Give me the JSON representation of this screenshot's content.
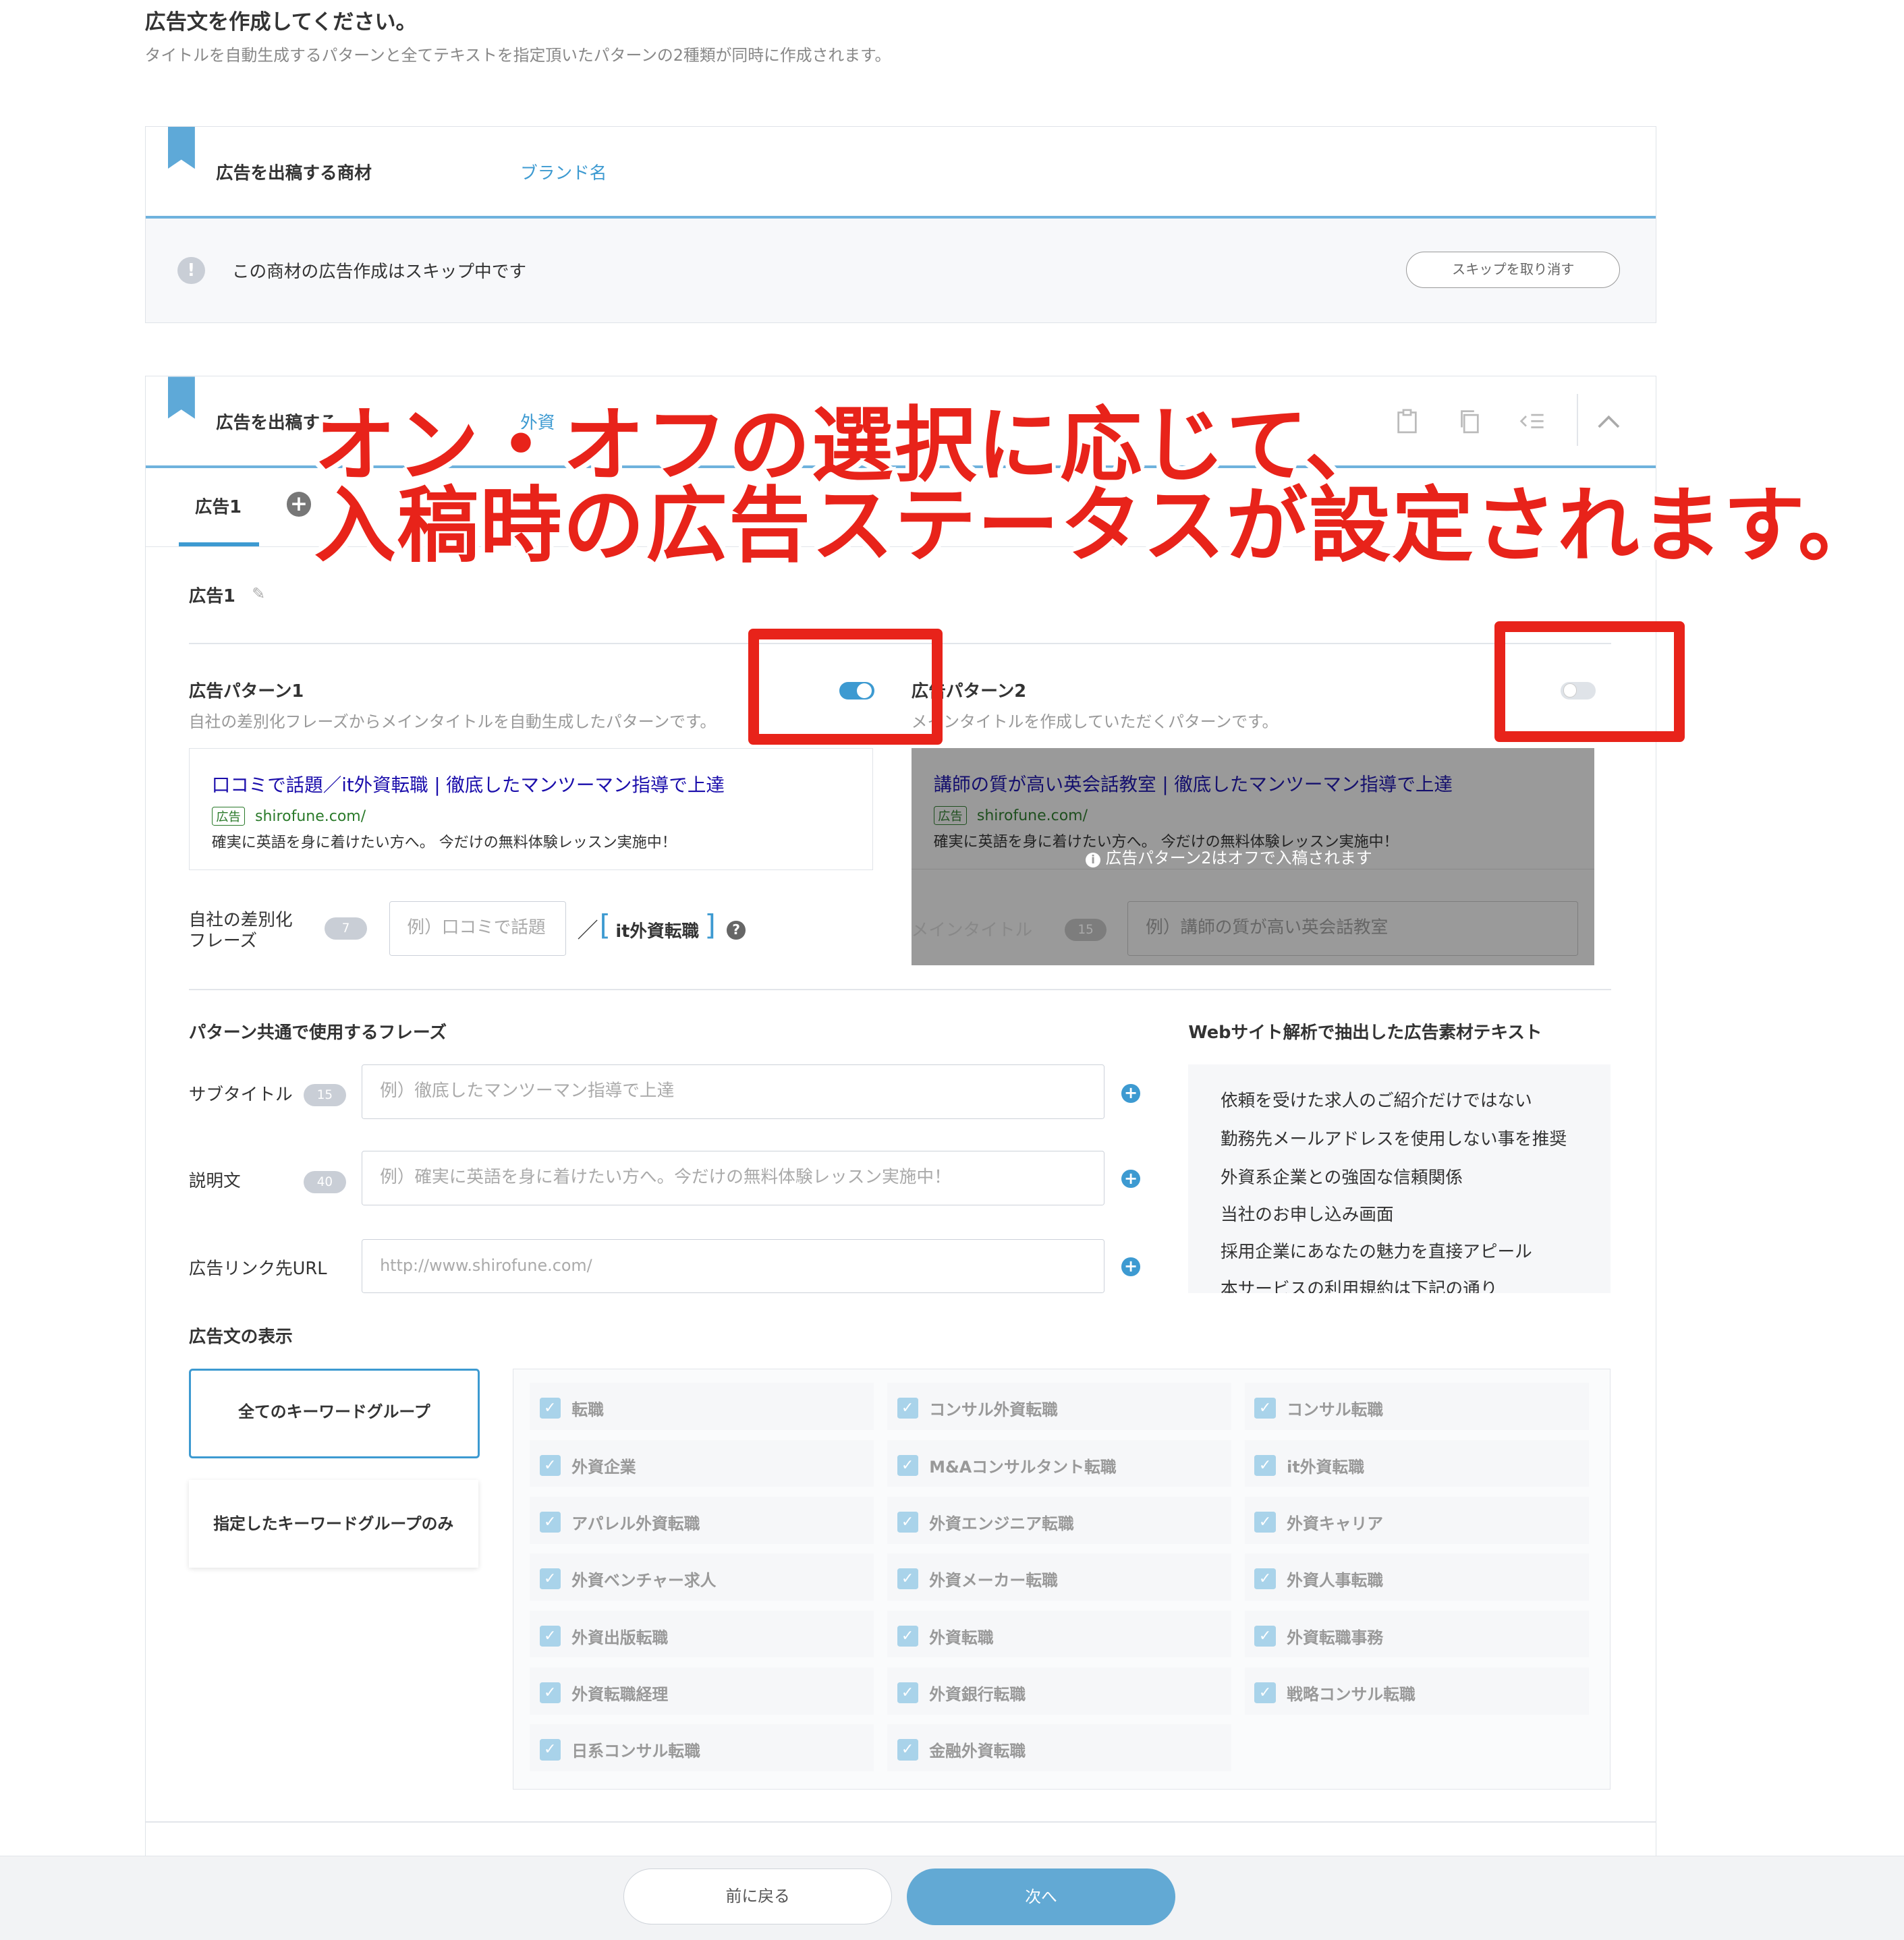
{
  "page": {
    "title": "広告文を作成してください。",
    "subtitle": "タイトルを自動生成するパターンと全てテキストを指定頂いたパターンの2種類が同時に作成されます。"
  },
  "card1": {
    "label": "広告を出稿する商材",
    "value": "ブランド名",
    "skip_message": "この商材の広告作成はスキップ中です",
    "skip_cancel": "スキップを取り消す"
  },
  "card2": {
    "label_visible": "広告を出稿する",
    "value_visible": "外資",
    "tab": "広告1",
    "ad_name": "広告1"
  },
  "overlay": {
    "line1": "オン・オフの選択に応じて、",
    "line2": "入稿時の広告ステータスが設定されます。"
  },
  "pattern1": {
    "title": "広告パターン1",
    "desc": "自社の差別化フレーズからメインタイトルを自動生成したパターンです。",
    "toggle_on": true,
    "preview_title": "口コミで話題／it外資転職 | 徹底したマンツーマン指導で上達",
    "badge": "広告",
    "url": "shirofune.com/",
    "preview_desc": "確実に英語を身に着けたい方へ。 今だけの無料体験レッスン実施中！",
    "field_label_1": "自社の差別化",
    "field_label_2": "フレーズ",
    "count": "7",
    "placeholder": "例）口コミで話題",
    "slash": "／",
    "keyword": "it外資転職"
  },
  "pattern2": {
    "title": "広告パターン2",
    "desc": "メインタイトルを作成していただくパターンです。",
    "toggle_on": false,
    "preview_title": "講師の質が高い英会話教室 | 徹底したマンツーマン指導で上達",
    "badge": "広告",
    "url": "shirofune.com/",
    "preview_desc": "確実に英語を身に着けたい方へ。 今だけの無料体験レッスン実施中！",
    "off_notice": "広告パターン2はオフで入稿されます",
    "field_label": "メインタイトル",
    "count": "15",
    "placeholder": "例）講師の質が高い英会話教室"
  },
  "common": {
    "heading": "パターン共通で使用するフレーズ",
    "subtitle_label": "サブタイトル",
    "subtitle_count": "15",
    "subtitle_placeholder": "例）徹底したマンツーマン指導で上達",
    "desc_label": "説明文",
    "desc_count": "40",
    "desc_placeholder": "例）確実に英語を身に着けたい方へ。今だけの無料体験レッスン実施中！",
    "url_label": "広告リンク先URL",
    "url_value": "http://www.shirofune.com/"
  },
  "web": {
    "heading": "Webサイト解析で抽出した広告素材テキスト",
    "items": [
      "依頼を受けた求人のご紹介だけではない",
      "勤務先メールアドレスを使用しない事を推奨",
      "外資系企業との強固な信頼関係",
      "当社のお申し込み画面",
      "採用企業にあなたの魅力を直接アピール",
      "本サービスの利用規約は下記の通り"
    ]
  },
  "display": {
    "heading": "広告文の表示",
    "all_groups": "全てのキーワードグループ",
    "specified_groups": "指定したキーワードグループのみ",
    "keywords": [
      "転職",
      "コンサル外資転職",
      "コンサル転職",
      "外資企業",
      "M&Aコンサルタント転職",
      "it外資転職",
      "アパレル外資転職",
      "外資エンジニア転職",
      "外資キャリア",
      "外資ベンチャー求人",
      "外資メーカー転職",
      "外資人事転職",
      "外資出版転職",
      "外資転職",
      "外資転職事務",
      "外資転職経理",
      "外資銀行転職",
      "戦略コンサル転職",
      "日系コンサル転職",
      "金融外資転職"
    ]
  },
  "footer": {
    "back": "前に戻る",
    "next": "次へ"
  },
  "colors": {
    "accent": "#3d9ad1",
    "overlay_red": "#e8231a",
    "toggle_on": "#3d9ad1"
  }
}
